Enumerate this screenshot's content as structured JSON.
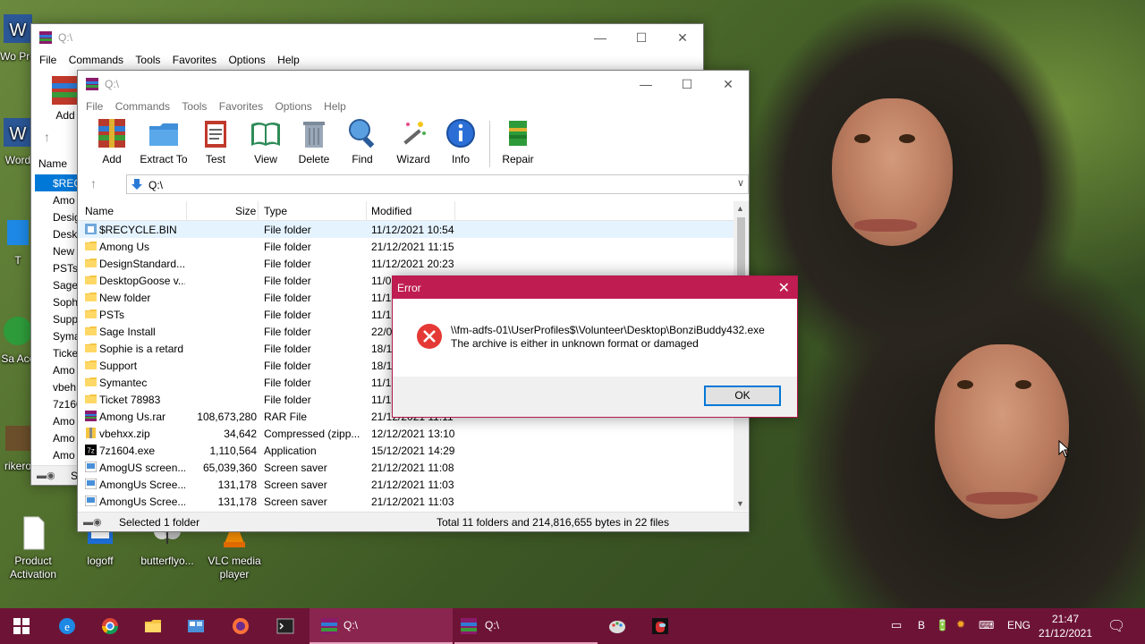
{
  "desktop": {
    "icons_left": [
      {
        "label": "Wo Pre",
        "icon": "word-icon"
      },
      {
        "label": "Word",
        "icon": "word-icon"
      },
      {
        "label": "T",
        "icon": "app-icon"
      },
      {
        "label": "Sa Acc",
        "icon": "app-icon"
      },
      {
        "label": "rikero",
        "icon": "app-icon"
      }
    ],
    "icons_bottom": [
      {
        "label": "Product Activation",
        "icon": "document-icon"
      },
      {
        "label": "logoff",
        "icon": "logoff-icon"
      },
      {
        "label": "butterflyo...",
        "icon": "butterfly-icon"
      },
      {
        "label": "VLC media player",
        "icon": "vlc-icon"
      }
    ]
  },
  "back_window": {
    "title": "Q:\\",
    "menu": [
      "File",
      "Commands",
      "Tools",
      "Favorites",
      "Options",
      "Help"
    ],
    "partial_toolbar_label": "Add",
    "partial_header": "Name",
    "partial_rows": [
      "$REC",
      "Amo",
      "Desig",
      "Deskt",
      "New",
      "PSTs",
      "Sage",
      "Soph",
      "Supp",
      "Syma",
      "Ticke",
      "Amo",
      "vbeh",
      "7z160",
      "Amo",
      "Amo",
      "Amo"
    ],
    "partial_status": "S"
  },
  "front_window": {
    "title": "Q:\\",
    "menu": [
      "File",
      "Commands",
      "Tools",
      "Favorites",
      "Options",
      "Help"
    ],
    "toolbar": [
      {
        "label": "Add",
        "icon": "add-archive-icon"
      },
      {
        "label": "Extract To",
        "icon": "extract-folder-icon"
      },
      {
        "label": "Test",
        "icon": "test-clipboard-icon"
      },
      {
        "label": "View",
        "icon": "view-book-icon"
      },
      {
        "label": "Delete",
        "icon": "trash-icon"
      },
      {
        "label": "Find",
        "icon": "magnifier-icon"
      },
      {
        "label": "Wizard",
        "icon": "wand-icon"
      },
      {
        "label": "Info",
        "icon": "info-icon"
      },
      {
        "label": "Repair",
        "icon": "repair-icon"
      }
    ],
    "address": "Q:\\",
    "columns": {
      "name": "Name",
      "size": "Size",
      "type": "Type",
      "modified": "Modified"
    },
    "rows": [
      {
        "name": "$RECYCLE.BIN",
        "size": "",
        "type": "File folder",
        "modified": "11/12/2021 10:54",
        "icon": "recycle-folder-icon"
      },
      {
        "name": "Among Us",
        "size": "",
        "type": "File folder",
        "modified": "21/12/2021 11:15",
        "icon": "folder-icon"
      },
      {
        "name": "DesignStandard...",
        "size": "",
        "type": "File folder",
        "modified": "11/12/2021 20:23",
        "icon": "folder-icon"
      },
      {
        "name": "DesktopGoose v...",
        "size": "",
        "type": "File folder",
        "modified": "11/0",
        "icon": "folder-icon"
      },
      {
        "name": "New folder",
        "size": "",
        "type": "File folder",
        "modified": "11/1",
        "icon": "folder-icon"
      },
      {
        "name": "PSTs",
        "size": "",
        "type": "File folder",
        "modified": "11/1",
        "icon": "folder-icon"
      },
      {
        "name": "Sage Install",
        "size": "",
        "type": "File folder",
        "modified": "22/0",
        "icon": "folder-icon"
      },
      {
        "name": "Sophie is a retard",
        "size": "",
        "type": "File folder",
        "modified": "18/1",
        "icon": "folder-icon"
      },
      {
        "name": "Support",
        "size": "",
        "type": "File folder",
        "modified": "18/1",
        "icon": "folder-icon"
      },
      {
        "name": "Symantec",
        "size": "",
        "type": "File folder",
        "modified": "11/1",
        "icon": "folder-icon"
      },
      {
        "name": "Ticket 78983",
        "size": "",
        "type": "File folder",
        "modified": "11/1",
        "icon": "folder-icon"
      },
      {
        "name": "Among Us.rar",
        "size": "108,673,280",
        "type": "RAR File",
        "modified": "21/12/2021 11:11",
        "icon": "rar-icon"
      },
      {
        "name": "vbehxx.zip",
        "size": "34,642",
        "type": "Compressed (zipp...",
        "modified": "12/12/2021 13:10",
        "icon": "zip-icon"
      },
      {
        "name": "7z1604.exe",
        "size": "1,110,564",
        "type": "Application",
        "modified": "15/12/2021 14:29",
        "icon": "7z-icon"
      },
      {
        "name": "AmogUS screen...",
        "size": "65,039,360",
        "type": "Screen saver",
        "modified": "21/12/2021 11:08",
        "icon": "screensaver-icon"
      },
      {
        "name": "AmongUs Scree...",
        "size": "131,178",
        "type": "Screen saver",
        "modified": "21/12/2021 11:03",
        "icon": "screensaver-icon"
      },
      {
        "name": "AmongUs Scree...",
        "size": "131,178",
        "type": "Screen saver",
        "modified": "21/12/2021 11:03",
        "icon": "screensaver-icon"
      }
    ],
    "status_left": "Selected 1 folder",
    "status_right": "Total 11 folders and 214,816,655 bytes in 22 files"
  },
  "error_dialog": {
    "title": "Error",
    "line1": "\\\\fm-adfs-01\\UserProfiles$\\Volunteer\\Desktop\\BonziBuddy432.exe",
    "line2": "The archive is either in unknown format or damaged",
    "ok_label": "OK",
    "close_glyph": "✕"
  },
  "taskbar": {
    "items": [
      {
        "icon": "windows-start-icon"
      },
      {
        "icon": "edge-icon"
      },
      {
        "icon": "chrome-icon"
      },
      {
        "icon": "file-explorer-icon"
      },
      {
        "icon": "control-panel-icon"
      },
      {
        "icon": "firefox-icon"
      },
      {
        "icon": "terminal-icon"
      },
      {
        "icon": "winrar-icon",
        "label": "Q:\\"
      },
      {
        "icon": "winrar-icon",
        "label": "Q:\\"
      },
      {
        "icon": "paint-icon"
      },
      {
        "icon": "among-us-icon"
      }
    ],
    "tray_b": "B",
    "tray_lang": "ENG",
    "time": "21:47",
    "date": "21/12/2021"
  },
  "colors": {
    "accent": "#0078d7",
    "dialog_title": "#bf1d52",
    "taskbar": "#6d1436"
  }
}
